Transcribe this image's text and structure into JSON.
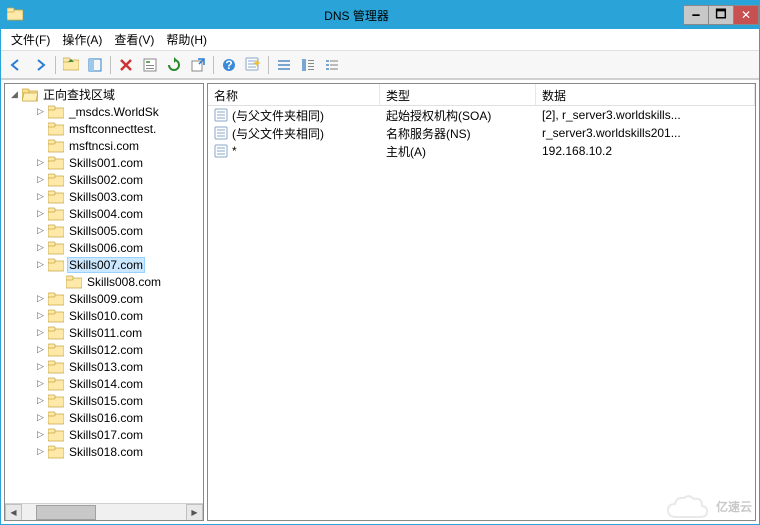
{
  "title": "DNS 管理器",
  "menu": {
    "file": "文件(F)",
    "action": "操作(A)",
    "view": "查看(V)",
    "help": "帮助(H)"
  },
  "tree": {
    "root": "正向查找区域",
    "items": [
      {
        "name": "_msdcs.WorldSk",
        "indent": 1,
        "exp": "▷"
      },
      {
        "name": "msftconnecttest.",
        "indent": 1,
        "exp": ""
      },
      {
        "name": "msftncsi.com",
        "indent": 1,
        "exp": ""
      },
      {
        "name": "Skills001.com",
        "indent": 1,
        "exp": "▷"
      },
      {
        "name": "Skills002.com",
        "indent": 1,
        "exp": "▷"
      },
      {
        "name": "Skills003.com",
        "indent": 1,
        "exp": "▷"
      },
      {
        "name": "Skills004.com",
        "indent": 1,
        "exp": "▷"
      },
      {
        "name": "Skills005.com",
        "indent": 1,
        "exp": "▷"
      },
      {
        "name": "Skills006.com",
        "indent": 1,
        "exp": "▷"
      },
      {
        "name": "Skills007.com",
        "indent": 1,
        "exp": "▷",
        "selected": true
      },
      {
        "name": "Skills008.com",
        "indent": 2,
        "exp": ""
      },
      {
        "name": "Skills009.com",
        "indent": 1,
        "exp": "▷"
      },
      {
        "name": "Skills010.com",
        "indent": 1,
        "exp": "▷"
      },
      {
        "name": "Skills011.com",
        "indent": 1,
        "exp": "▷"
      },
      {
        "name": "Skills012.com",
        "indent": 1,
        "exp": "▷"
      },
      {
        "name": "Skills013.com",
        "indent": 1,
        "exp": "▷"
      },
      {
        "name": "Skills014.com",
        "indent": 1,
        "exp": "▷"
      },
      {
        "name": "Skills015.com",
        "indent": 1,
        "exp": "▷"
      },
      {
        "name": "Skills016.com",
        "indent": 1,
        "exp": "▷"
      },
      {
        "name": "Skills017.com",
        "indent": 1,
        "exp": "▷"
      },
      {
        "name": "Skills018.com",
        "indent": 1,
        "exp": "▷"
      }
    ]
  },
  "columns": {
    "name": "名称",
    "type": "类型",
    "data": "数据"
  },
  "records": [
    {
      "name": "(与父文件夹相同)",
      "type": "起始授权机构(SOA)",
      "data": "[2], r_server3.worldskills..."
    },
    {
      "name": "(与父文件夹相同)",
      "type": "名称服务器(NS)",
      "data": "r_server3.worldskills201..."
    },
    {
      "name": "*",
      "type": "主机(A)",
      "data": "192.168.10.2"
    }
  ],
  "watermark": "亿速云"
}
